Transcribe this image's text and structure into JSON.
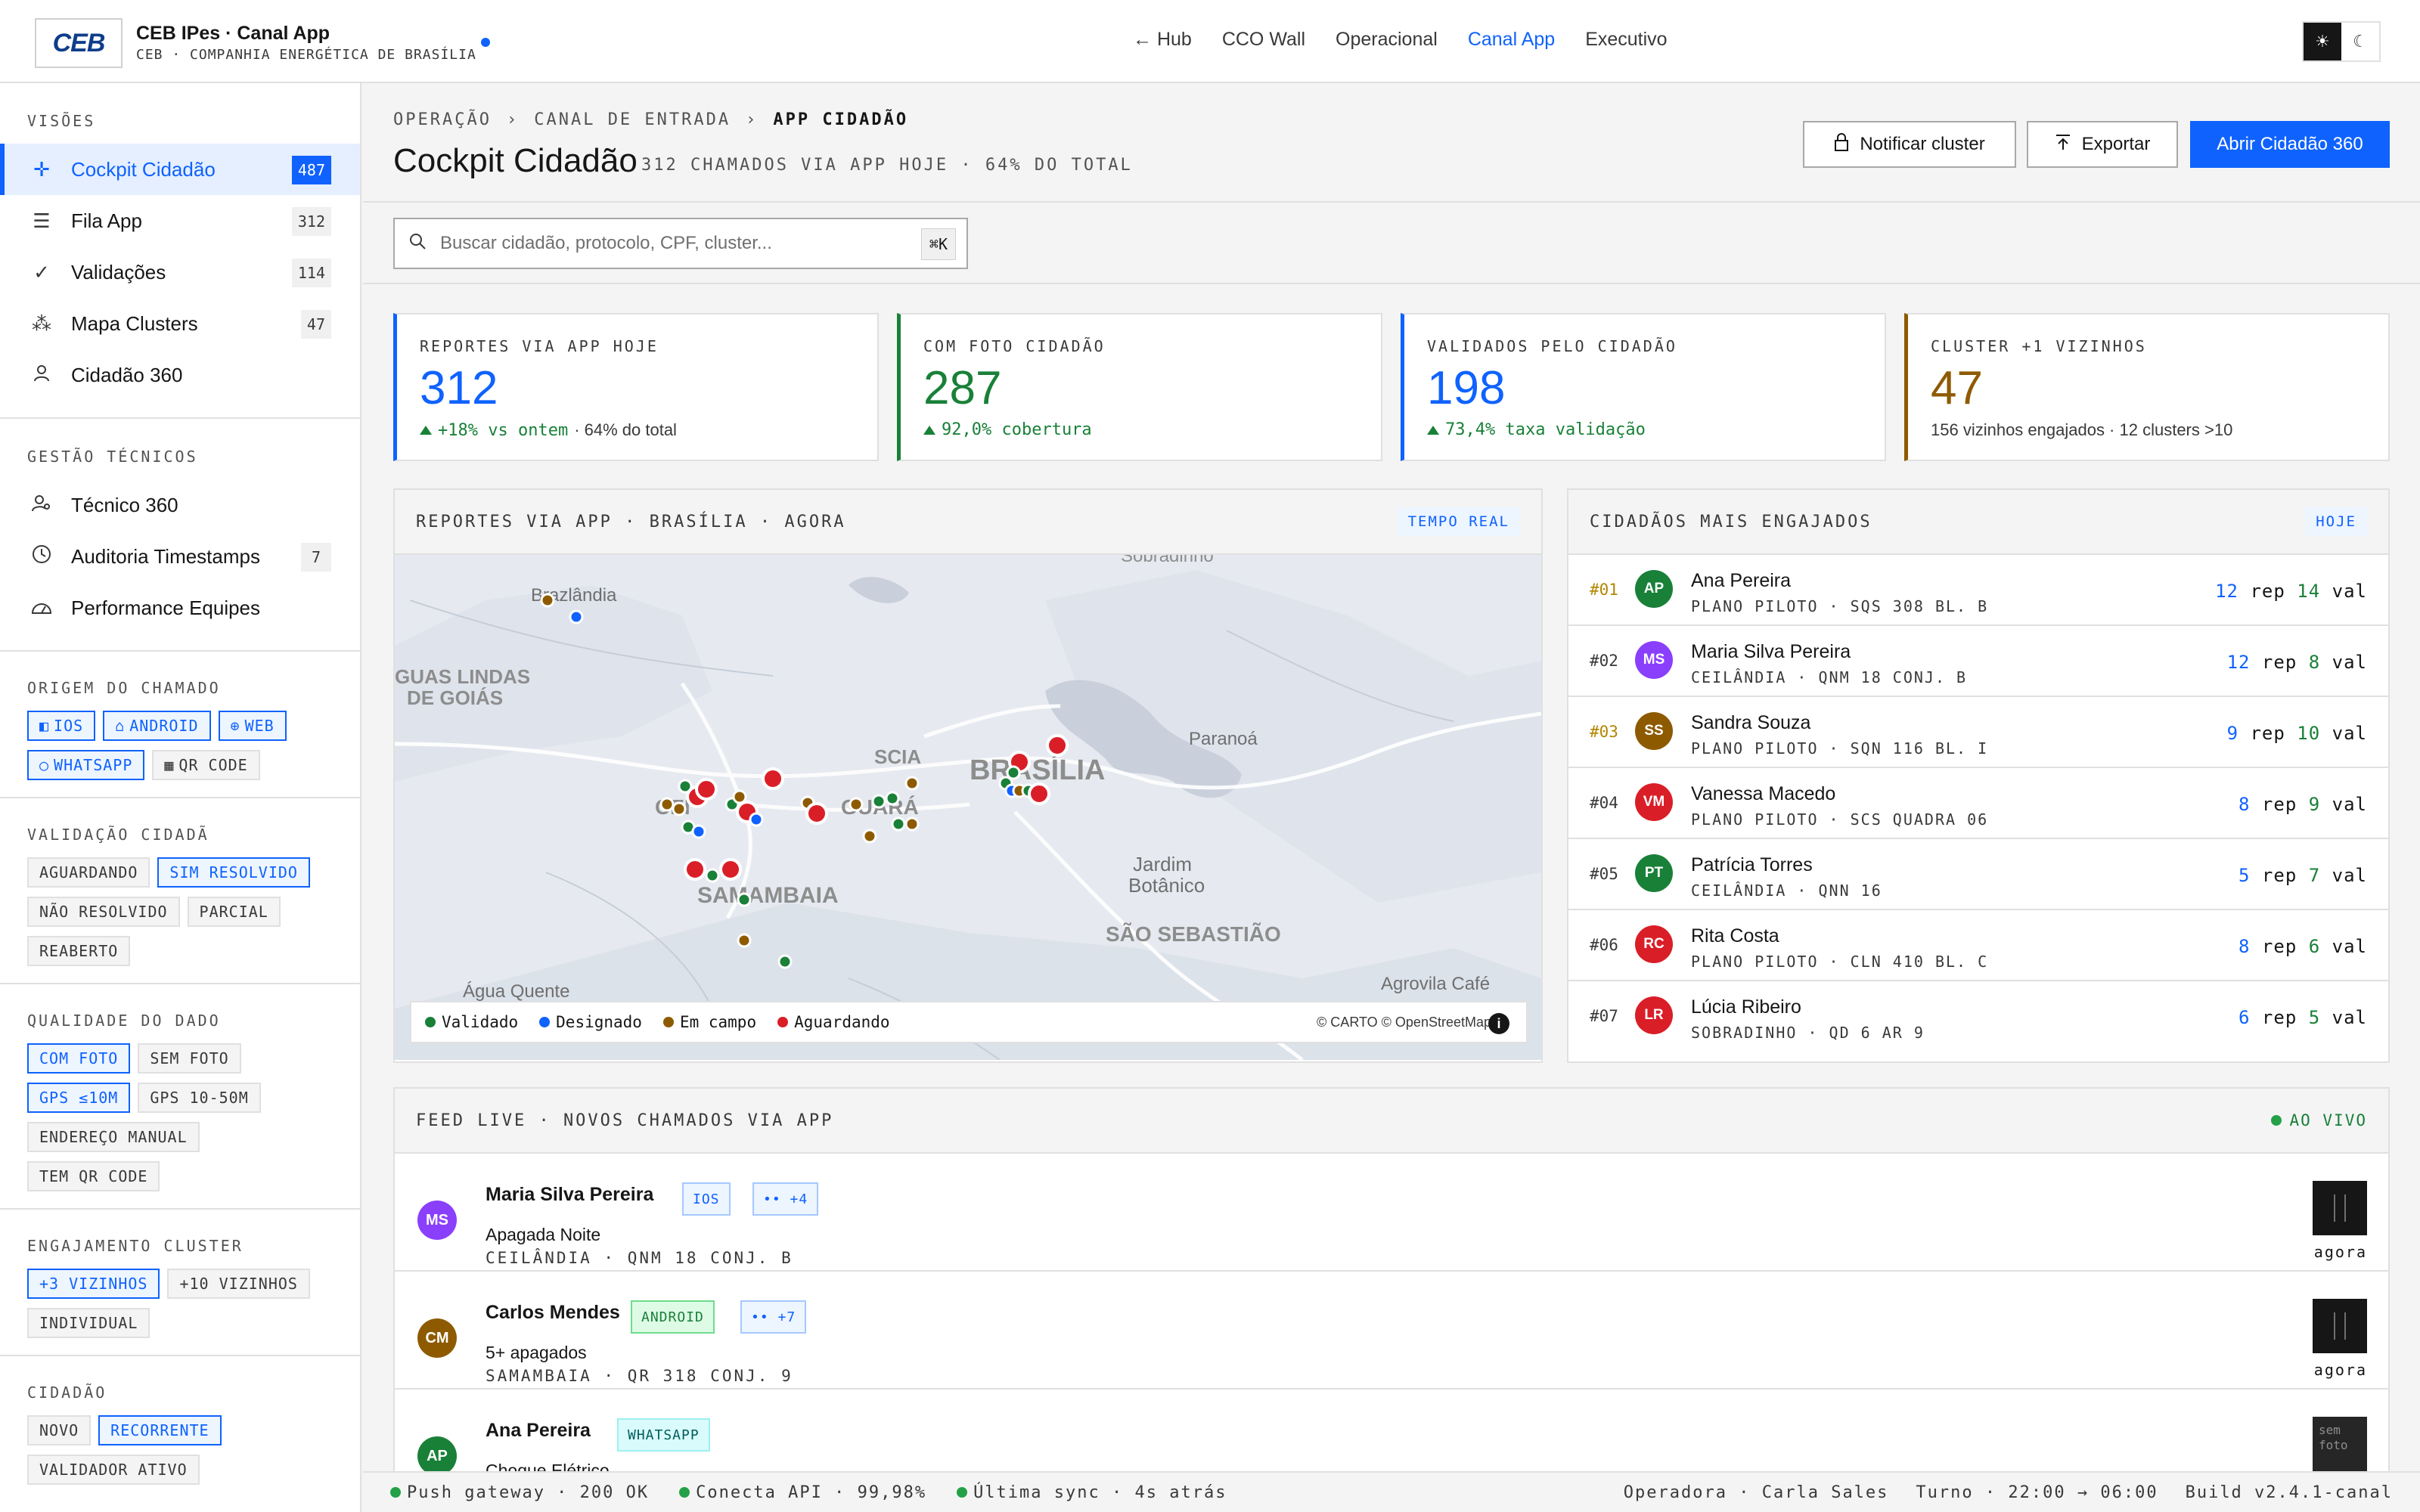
{
  "header": {
    "logo": "CEB",
    "title": "CEB IPes · Canal App",
    "subtitle": "CEB · COMPANHIA ENERGÉTICA DE BRASÍLIA",
    "nav": [
      "← Hub",
      "CCO Wall",
      "Operacional",
      "Canal App",
      "Executivo"
    ],
    "nav_active": "Canal App",
    "theme_light": "☀",
    "theme_dark": "☾"
  },
  "sidebar": {
    "visoes": {
      "heading": "VISÕES",
      "items": [
        {
          "label": "Cockpit Cidadão",
          "count": "487",
          "icon": "crosshair-icon",
          "active": true
        },
        {
          "label": "Fila App",
          "count": "312",
          "icon": "list-icon"
        },
        {
          "label": "Validações",
          "count": "114",
          "icon": "check-icon"
        },
        {
          "label": "Mapa Clusters",
          "count": "47",
          "icon": "cluster-icon"
        },
        {
          "label": "Cidadão 360",
          "count": "",
          "icon": "user-icon"
        }
      ]
    },
    "gestao": {
      "heading": "GESTÃO TÉCNICOS",
      "items": [
        {
          "label": "Técnico 360",
          "count": "",
          "icon": "user-search-icon"
        },
        {
          "label": "Auditoria Timestamps",
          "count": "7",
          "icon": "clock-icon"
        },
        {
          "label": "Performance Equipes",
          "count": "",
          "icon": "gauge-icon"
        }
      ]
    },
    "filters": [
      {
        "heading": "ORIGEM DO CHAMADO",
        "chips": [
          {
            "label": "IOS",
            "selected": true,
            "icon": "apple-icon"
          },
          {
            "label": "ANDROID",
            "selected": true,
            "icon": "android-icon"
          },
          {
            "label": "WEB",
            "selected": true,
            "icon": "globe-icon"
          },
          {
            "label": "WHATSAPP",
            "selected": true,
            "icon": "chat-icon"
          },
          {
            "label": "QR CODE",
            "selected": false,
            "icon": "qr-icon"
          }
        ]
      },
      {
        "heading": "VALIDAÇÃO CIDADÃ",
        "chips": [
          {
            "label": "AGUARDANDO",
            "selected": false
          },
          {
            "label": "SIM RESOLVIDO",
            "selected": true
          },
          {
            "label": "NÃO RESOLVIDO",
            "selected": false
          },
          {
            "label": "PARCIAL",
            "selected": false
          },
          {
            "label": "REABERTO",
            "selected": false
          }
        ]
      },
      {
        "heading": "QUALIDADE DO DADO",
        "chips": [
          {
            "label": "COM FOTO",
            "selected": true
          },
          {
            "label": "SEM FOTO",
            "selected": false
          },
          {
            "label": "GPS ≤10M",
            "selected": true
          },
          {
            "label": "GPS 10-50M",
            "selected": false
          },
          {
            "label": "ENDEREÇO MANUAL",
            "selected": false
          },
          {
            "label": "TEM QR CODE",
            "selected": false
          }
        ]
      },
      {
        "heading": "ENGAJAMENTO CLUSTER",
        "chips": [
          {
            "label": "+3 VIZINHOS",
            "selected": true
          },
          {
            "label": "+10 VIZINHOS",
            "selected": false
          },
          {
            "label": "INDIVIDUAL",
            "selected": false
          }
        ]
      },
      {
        "heading": "CIDADÃO",
        "chips": [
          {
            "label": "NOVO",
            "selected": false
          },
          {
            "label": "RECORRENTE",
            "selected": true
          },
          {
            "label": "VALIDADOR ATIVO",
            "selected": false
          }
        ]
      }
    ]
  },
  "page": {
    "breadcrumb": [
      "OPERAÇÃO",
      "CANAL DE ENTRADA",
      "APP CIDADÃO"
    ],
    "sep": "›",
    "title": "Cockpit Cidadão",
    "subtitle": "312 CHAMADOS VIA APP HOJE · 64% DO TOTAL",
    "btn_notify": "Notificar cluster",
    "btn_export": "Exportar",
    "btn_open": "Abrir Cidadão 360"
  },
  "search": {
    "placeholder": "Buscar cidadão, protocolo, CPF, cluster...",
    "shortcut": "⌘K"
  },
  "kpis": [
    {
      "label": "REPORTES VIA APP HOJE",
      "value": "312",
      "delta": "+18% vs ontem",
      "extra": "· 64% do total",
      "color": "#0f62fe",
      "trend": "up"
    },
    {
      "label": "COM FOTO CIDADÃO",
      "value": "287",
      "delta": "92,0% cobertura",
      "extra": "",
      "color": "#198038",
      "trend": "up"
    },
    {
      "label": "VALIDADOS PELO CIDADÃO",
      "value": "198",
      "delta": "73,4% taxa validação",
      "extra": "",
      "color": "#0f62fe",
      "trend": "up"
    },
    {
      "label": "CLUSTER +1 VIZINHOS",
      "value": "47",
      "delta": "",
      "extra": "156 vizinhos engajados · 12 clusters >10",
      "color": "#8e5a00",
      "trend": "none"
    }
  ],
  "map": {
    "title": "REPORTES VIA APP · BRASÍLIA · AGORA",
    "badge": "TEMPO REAL",
    "place_labels": [
      "Brazlândia",
      "GUAS LINDAS",
      "DE GOIÁS",
      "CEI",
      "SCIA",
      "BRASÍLIA",
      "Paranoá",
      "Jardim",
      "Botânico",
      "SAMAMBAIA",
      "SÃO SEBASTIÃO",
      "Água Quente",
      "Agrovila Café",
      "Sobradinho",
      "GUARÁ"
    ],
    "legend": [
      {
        "label": "Validado",
        "color": "#198038"
      },
      {
        "label": "Designado",
        "color": "#0f62fe"
      },
      {
        "label": "Em campo",
        "color": "#8e5a00"
      },
      {
        "label": "Aguardando",
        "color": "#da1e28"
      }
    ],
    "attribution": "© CARTO © OpenStreetMap",
    "info": "i"
  },
  "engaged": {
    "title": "CIDADÃOS MAIS ENGAJADOS",
    "badge": "HOJE",
    "rep_label": "rep",
    "val_label": "val",
    "rows": [
      {
        "rank": "#01",
        "initials": "AP",
        "name": "Ana Pereira",
        "loc": "PLANO PILOTO · SQS 308 BL. B",
        "rep": "12",
        "val": "14",
        "color": "#198038",
        "highlight": true
      },
      {
        "rank": "#02",
        "initials": "MS",
        "name": "Maria Silva Pereira",
        "loc": "CEILÂNDIA · QNM 18 CONJ. B",
        "rep": "12",
        "val": "8",
        "color": "#8a3ffc"
      },
      {
        "rank": "#03",
        "initials": "SS",
        "name": "Sandra Souza",
        "loc": "PLANO PILOTO · SQN 116 BL. I",
        "rep": "9",
        "val": "10",
        "color": "#8e5a00",
        "highlight": true
      },
      {
        "rank": "#04",
        "initials": "VM",
        "name": "Vanessa Macedo",
        "loc": "PLANO PILOTO · SCS QUADRA 06",
        "rep": "8",
        "val": "9",
        "color": "#da1e28"
      },
      {
        "rank": "#05",
        "initials": "PT",
        "name": "Patrícia Torres",
        "loc": "CEILÂNDIA · QNN 16",
        "rep": "5",
        "val": "7",
        "color": "#198038"
      },
      {
        "rank": "#06",
        "initials": "RC",
        "name": "Rita Costa",
        "loc": "PLANO PILOTO · CLN 410 BL. C",
        "rep": "8",
        "val": "6",
        "color": "#da1e28"
      },
      {
        "rank": "#07",
        "initials": "LR",
        "name": "Lúcia Ribeiro",
        "loc": "SOBRADINHO · QD 6 AR 9",
        "rep": "6",
        "val": "5",
        "color": "#da1e28"
      }
    ]
  },
  "feed": {
    "title": "FEED LIVE · NOVOS CHAMADOS VIA APP",
    "live": "AO VIVO",
    "items": [
      {
        "initials": "MS",
        "name": "Maria Silva Pereira",
        "tag": "IOS",
        "tag_type": "blue",
        "cluster": "•• +4",
        "title": "Apagada Noite",
        "loc": "CEILÂNDIA · QNM 18 CONJ. B",
        "time": "agora",
        "color": "#8a3ffc",
        "photo": true
      },
      {
        "initials": "CM",
        "name": "Carlos Mendes",
        "tag": "ANDROID",
        "tag_type": "green",
        "cluster": "•• +7",
        "title": "5+ apagados",
        "loc": "SAMAMBAIA · QR 318 CONJ. 9",
        "time": "agora",
        "color": "#8e5a00",
        "photo": true
      },
      {
        "initials": "AP",
        "name": "Ana Pereira",
        "tag": "WHATSAPP",
        "tag_type": "teal",
        "cluster": "",
        "title": "Choque Elétrico",
        "loc": "",
        "time": "",
        "color": "#198038",
        "photo": false,
        "photo_label": "sem foto"
      }
    ]
  },
  "status": {
    "items": [
      "Push gateway · 200 OK",
      "Conecta API · 99,98%",
      "Última sync · 4s atrás"
    ],
    "operator": "Operadora · Carla Sales",
    "shift": "Turno · 22:00 → 06:00",
    "build": "Build v2.4.1-canal"
  }
}
